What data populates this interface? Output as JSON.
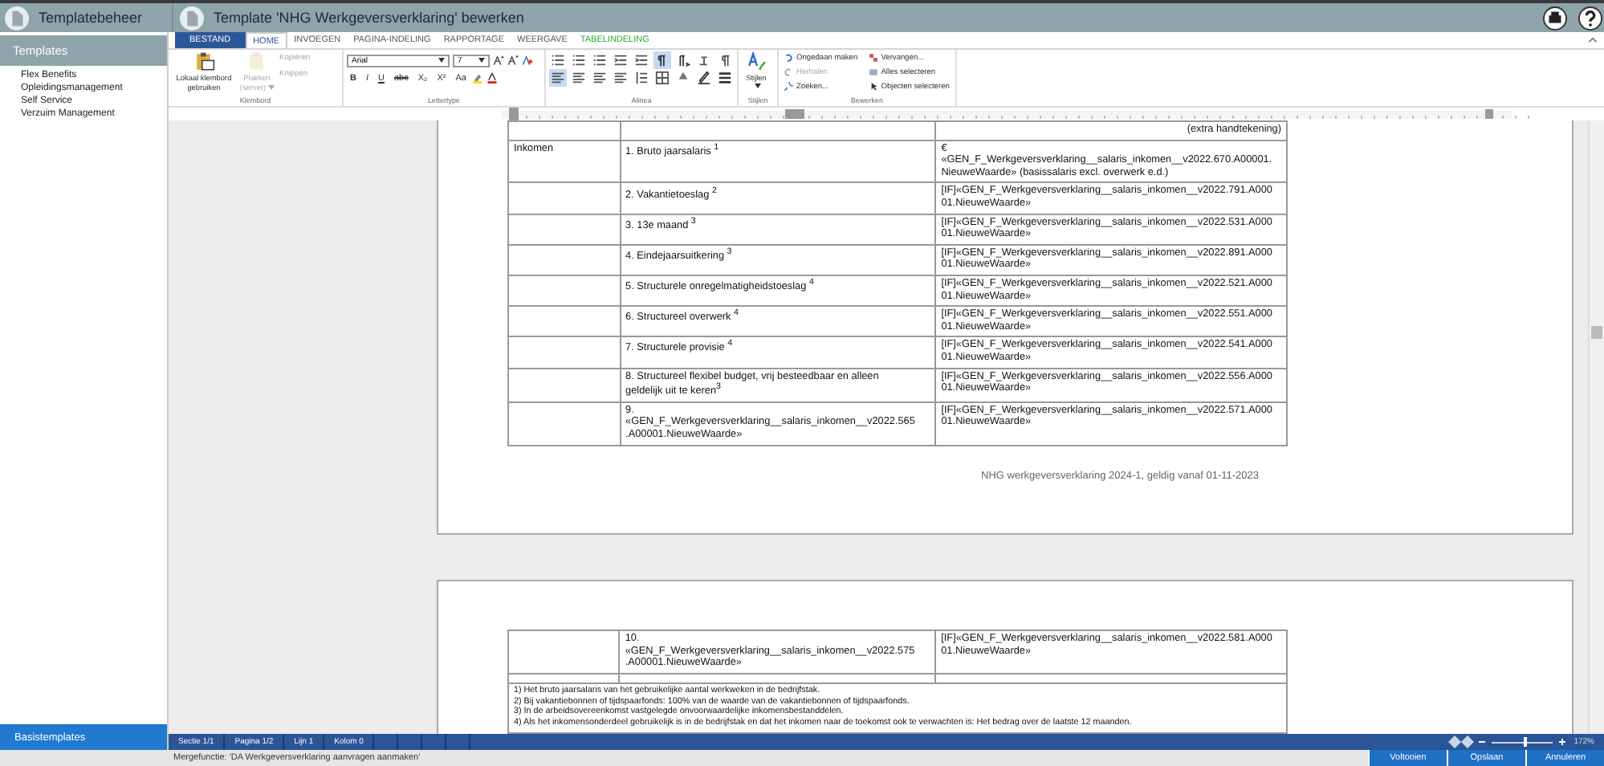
{
  "app": {
    "title": "Templatebeheer"
  },
  "editor": {
    "title": "Template 'NHG Werkgeversverklaring' bewerken"
  },
  "sidebar": {
    "header": "Templates",
    "items": [
      {
        "label": "Flex Benefits",
        "selected": false
      },
      {
        "label": "Opleidingsmanagement",
        "selected": false
      },
      {
        "label": "Self Service",
        "selected": false
      },
      {
        "label": "Verzuim Management",
        "selected": false
      }
    ],
    "footer_button": "Basistemplates"
  },
  "ribbon_tabs": [
    {
      "label": "BESTAND",
      "kind": "file",
      "selected": false
    },
    {
      "label": "HOME",
      "kind": "tab",
      "selected": true
    },
    {
      "label": "INVOEGEN",
      "kind": "tab",
      "selected": false
    },
    {
      "label": "PAGINA-INDELING",
      "kind": "tab",
      "selected": false
    },
    {
      "label": "RAPPORTAGE",
      "kind": "tab",
      "selected": false
    },
    {
      "label": "WEERGAVE",
      "kind": "tab",
      "selected": false
    },
    {
      "label": "TABELINDELING",
      "kind": "context",
      "selected": false
    }
  ],
  "clipboard": {
    "title": "Klembord",
    "local": {
      "label": "Lokaal klembord gebruiken",
      "disabled": false
    },
    "paste": {
      "label": "Plakken (server)",
      "disabled": true
    },
    "small": [
      {
        "label": "Kopiëren",
        "disabled": true
      },
      {
        "label": "Knippen",
        "disabled": true
      }
    ]
  },
  "font": {
    "title": "Lettertype",
    "family": "Arial",
    "size": "7",
    "format_buttons": [
      "B",
      "I",
      "U",
      "abc",
      "X₂",
      "X²",
      "Aa"
    ]
  },
  "paragraph": {
    "title": "Alinea",
    "tools": [
      {
        "kind": "list",
        "selected": false
      },
      {
        "kind": "list",
        "selected": false
      },
      {
        "kind": "list",
        "selected": false
      },
      {
        "kind": "indent",
        "selected": false
      },
      {
        "kind": "indent",
        "selected": false
      },
      {
        "kind": "ltr",
        "selected": true
      },
      {
        "kind": "rtl",
        "selected": false
      },
      {
        "kind": "sort",
        "selected": false
      },
      {
        "kind": "pilcrow",
        "selected": false
      }
    ],
    "tools2": [
      {
        "kind": "align",
        "selected": true
      },
      {
        "kind": "align",
        "selected": false
      },
      {
        "kind": "align",
        "selected": false
      },
      {
        "kind": "align",
        "selected": false
      },
      {
        "kind": "spacing",
        "selected": false
      },
      {
        "kind": "border",
        "selected": false
      },
      {
        "kind": "shade",
        "selected": false
      },
      {
        "kind": "pen",
        "selected": false
      },
      {
        "kind": "lines",
        "selected": false
      }
    ]
  },
  "styles": {
    "title": "Stijlen",
    "button": "Stijlen"
  },
  "editing": {
    "title": "Bewerken",
    "items": [
      {
        "label": "Ongedaan maken",
        "kind": "undo",
        "disabled": false
      },
      {
        "label": "Vervangen...",
        "kind": "replace",
        "disabled": false
      },
      {
        "label": "Herhalen",
        "kind": "redo",
        "disabled": true
      },
      {
        "label": "Alles selecteren",
        "kind": "selectall",
        "disabled": false
      },
      {
        "label": "Zoeken...",
        "kind": "search",
        "disabled": false
      },
      {
        "label": "Objecten selecteren",
        "kind": "pointer",
        "disabled": false
      }
    ]
  },
  "document": {
    "page1": {
      "header_note": "(extra handtekening)",
      "rows": [
        {
          "label": "Inkomen",
          "item": [
            "1.  Bruto jaarsalaris $^{1}$"
          ],
          "value": [
            "€",
            "«GEN_F_Werkgeversverklaring__salaris_inkomen__v2022.670.A00001.",
            "NieuweWaarde» (basissalaris excl. overwerk e.d.)"
          ]
        },
        {
          "label": "",
          "item": [
            "2.  Vakantietoeslag $^{2}$"
          ],
          "value": [
            "[IF]«GEN_F_Werkgeversverklaring__salaris_inkomen__v2022.791.A000",
            "01.NieuweWaarde»"
          ]
        },
        {
          "label": "",
          "item": [
            "3.  13e maand $^{3}$"
          ],
          "value": [
            "[IF]«GEN_F_Werkgeversverklaring__salaris_inkomen__v2022.531.A000",
            "01.NieuweWaarde»"
          ]
        },
        {
          "label": "",
          "item": [
            "4.  Eindejaarsuitkering $^{3}$"
          ],
          "value": [
            "[IF]«GEN_F_Werkgeversverklaring__salaris_inkomen__v2022.891.A000",
            "01.NieuweWaarde»"
          ]
        },
        {
          "label": "",
          "item": [
            "5.  Structurele onregelmatigheidstoeslag $^{4}$"
          ],
          "value": [
            "[IF]«GEN_F_Werkgeversverklaring__salaris_inkomen__v2022.521.A000",
            "01.NieuweWaarde»"
          ]
        },
        {
          "label": "",
          "item": [
            "6.  Structureel overwerk $^{4}$"
          ],
          "value": [
            "[IF]«GEN_F_Werkgeversverklaring__salaris_inkomen__v2022.551.A000",
            "01.NieuweWaarde»"
          ]
        },
        {
          "label": "",
          "item": [
            "7.  Structurele provisie $^{4}$"
          ],
          "value": [
            "[IF]«GEN_F_Werkgeversverklaring__salaris_inkomen__v2022.541.A000",
            "01.NieuweWaarde»"
          ]
        },
        {
          "label": "",
          "item": [
            "8.  Structureel flexibel budget, vrij besteedbaar en alleen",
            "geldelijk uit te keren$^{3}$"
          ],
          "value": [
            "[IF]«GEN_F_Werkgeversverklaring__salaris_inkomen__v2022.556.A000",
            "01.NieuweWaarde»"
          ]
        },
        {
          "label": "",
          "item": [
            "9.",
            "«GEN_F_Werkgeversverklaring__salaris_inkomen__v2022.565",
            ".A00001.NieuweWaarde»"
          ],
          "value": [
            "[IF]«GEN_F_Werkgeversverklaring__salaris_inkomen__v2022.571.A000",
            "01.NieuweWaarde»"
          ]
        }
      ],
      "footer": "NHG werkgeversverklaring 2024-1, geldig vanaf 01-11-2023"
    },
    "page2": {
      "rows": [
        {
          "label": "",
          "item": [
            "10.",
            "«GEN_F_Werkgeversverklaring__salaris_inkomen__v2022.575",
            ".A00001.NieuweWaarde»"
          ],
          "value": [
            "[IF]«GEN_F_Werkgeversverklaring__salaris_inkomen__v2022.581.A000",
            "01.NieuweWaarde»"
          ]
        },
        {
          "label": "",
          "item": [],
          "value": []
        }
      ],
      "footnotes": [
        "1) Het bruto jaarsalaris van het gebruikelijke aantal werkweken in de bedrijfstak.",
        "2) Bij vakantiebonnen of tijdspaarfonds: 100% van de waarde van de vakantiebonnen of tijdspaarfonds.",
        "3) In de arbeidsovereenkomst vastgelegde onvoorwaardelijke inkomensbestanddelen.",
        "4) Als het inkomensonderdeel gebruikelijk is in de bedrijfstak en dat het inkomen naar de toekomst ook te verwachten is: Het bedrag over de laatste 12 maanden."
      ]
    }
  },
  "status_bar": {
    "cells": [
      "Sectie 1/1",
      "Pagina 1/2",
      "Lijn 1",
      "Kolom 0"
    ],
    "zoom": {
      "level": 0.55,
      "reading": "172%"
    }
  },
  "bottom_bar": {
    "message": "Mergefunctie: 'DA Werkgeversverklaring aanvragen aanmaken'",
    "buttons": [
      "Voltooien",
      "Opslaan",
      "Annuleren"
    ]
  }
}
